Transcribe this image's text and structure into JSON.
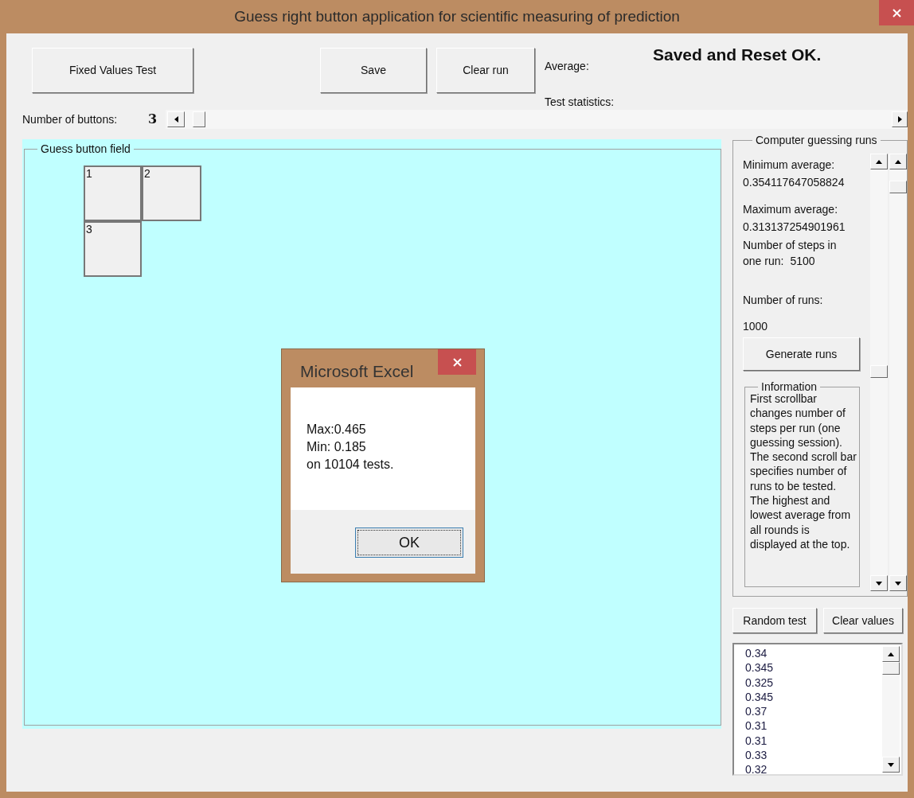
{
  "window": {
    "title": "Guess right button application for scientific measuring of prediction"
  },
  "toolbar": {
    "buttons": [
      "Fixed Values Test",
      "Save",
      "Clear run"
    ],
    "average_label": "Average:",
    "statistics_label": "Test statistics:",
    "status_message": "Saved and Reset OK."
  },
  "buttons_count": {
    "label": "Number of buttons:",
    "value": "3"
  },
  "guess_field": {
    "title": "Guess button field",
    "buttons": [
      "1",
      "2",
      "3"
    ]
  },
  "guessing_runs": {
    "title": "Computer guessing runs",
    "min_label": "Minimum average:",
    "min_value": "0.354117647058824",
    "max_label": "Maximum average:",
    "max_value": "0.313137254901961",
    "steps_label": "Number of steps in one run:",
    "steps_value": "5100",
    "runs_label": "Number of runs:",
    "runs_value": "1000",
    "generate_button": "Generate runs",
    "information": {
      "title": "Information",
      "text": "First scrollbar changes number of steps per run (one guessing session). The second scroll bar specifies number of runs to be tested. The highest and lowest average from all rounds is displayed at the top."
    }
  },
  "actions": [
    "Random test",
    "Clear values"
  ],
  "values_list": [
    "0.34",
    "0.345",
    "0.325",
    "0.345",
    "0.37",
    "0.31",
    "0.31",
    "0.33",
    "0.32"
  ],
  "dialog": {
    "title": "Microsoft Excel",
    "message": "Max:0.465\nMin: 0.185\non 10104 tests.",
    "button": "OK"
  }
}
